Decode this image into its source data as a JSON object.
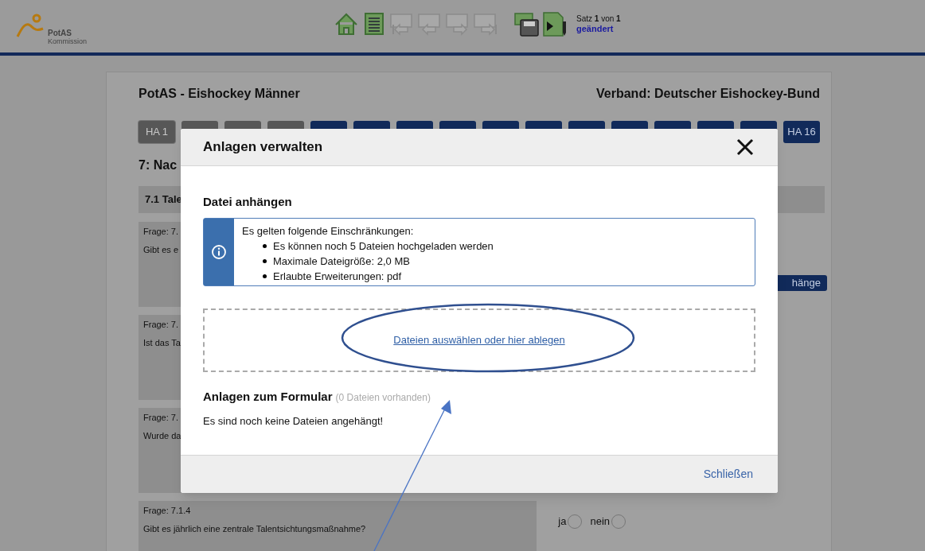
{
  "header": {
    "logo": {
      "name": "PotAS",
      "subtitle": "Kommission"
    },
    "toolbar": [
      {
        "kind": "home",
        "disabled": false
      },
      {
        "kind": "list",
        "disabled": false
      },
      {
        "kind": "first",
        "disabled": true
      },
      {
        "kind": "prev",
        "disabled": true
      },
      {
        "kind": "next",
        "disabled": true
      },
      {
        "kind": "last",
        "disabled": true
      },
      {
        "kind": "save",
        "disabled": false
      },
      {
        "kind": "export",
        "disabled": false
      }
    ],
    "record": "Satz **1** von **1**",
    "status": "geändert"
  },
  "page": {
    "title": "PotAS - Eishockey Männer",
    "federation": "Verband: Deutscher Eishockey-Bund",
    "tabs": [
      {
        "label": "HA 1",
        "kind": "done",
        "selected": true
      },
      {
        "kind": "done",
        "selected": false
      },
      {
        "kind": "done",
        "selected": false
      },
      {
        "kind": "done",
        "selected": false
      },
      {
        "kind": "open",
        "selected": false
      },
      {
        "kind": "open",
        "selected": false
      },
      {
        "kind": "open",
        "selected": false
      },
      {
        "kind": "open",
        "selected": false
      },
      {
        "kind": "open",
        "selected": false
      },
      {
        "kind": "open",
        "selected": false
      },
      {
        "kind": "open",
        "selected": false
      },
      {
        "kind": "open",
        "selected": false
      },
      {
        "kind": "open",
        "selected": false
      },
      {
        "kind": "open",
        "selected": false
      },
      {
        "kind": "open",
        "selected": false
      },
      {
        "label": "HA 16",
        "kind": "open",
        "selected": false
      }
    ],
    "chapter": "7: Nac",
    "section": "7.1 Tale",
    "questions": [
      {
        "label": "Frage: 7.",
        "text": "Gibt es e",
        "action": "hänge"
      },
      {
        "label": "Frage: 7.",
        "text": "Ist das Ta"
      },
      {
        "label": "Frage: 7.",
        "text": "Wurde da"
      },
      {
        "label": "Frage: 7.1.4",
        "text": "Gibt es jährlich eine zentrale Talentsichtungsmaßnahme?",
        "options": [
          {
            "label": "ja",
            "checked": false
          },
          {
            "label": "nein",
            "checked": false
          }
        ]
      }
    ]
  },
  "dialog": {
    "title": "Anlagen verwalten",
    "upload_heading": "Datei anhängen",
    "info": {
      "intro": "Es gelten folgende Einschränkungen:",
      "items": [
        "Es können noch 5 Dateien hochgeladen werden",
        "Maximale Dateigröße: 2,0 MB",
        "Erlaubte Erweiterungen: pdf"
      ]
    },
    "dropzone_link": "Dateien auswählen oder hier ablegen",
    "attachments_heading": "Anlagen zum Formular",
    "attachments_count": "(0 Dateien vorhanden)",
    "empty_message": "Es sind noch keine Dateien angehängt!",
    "close_link": "Schließen"
  }
}
